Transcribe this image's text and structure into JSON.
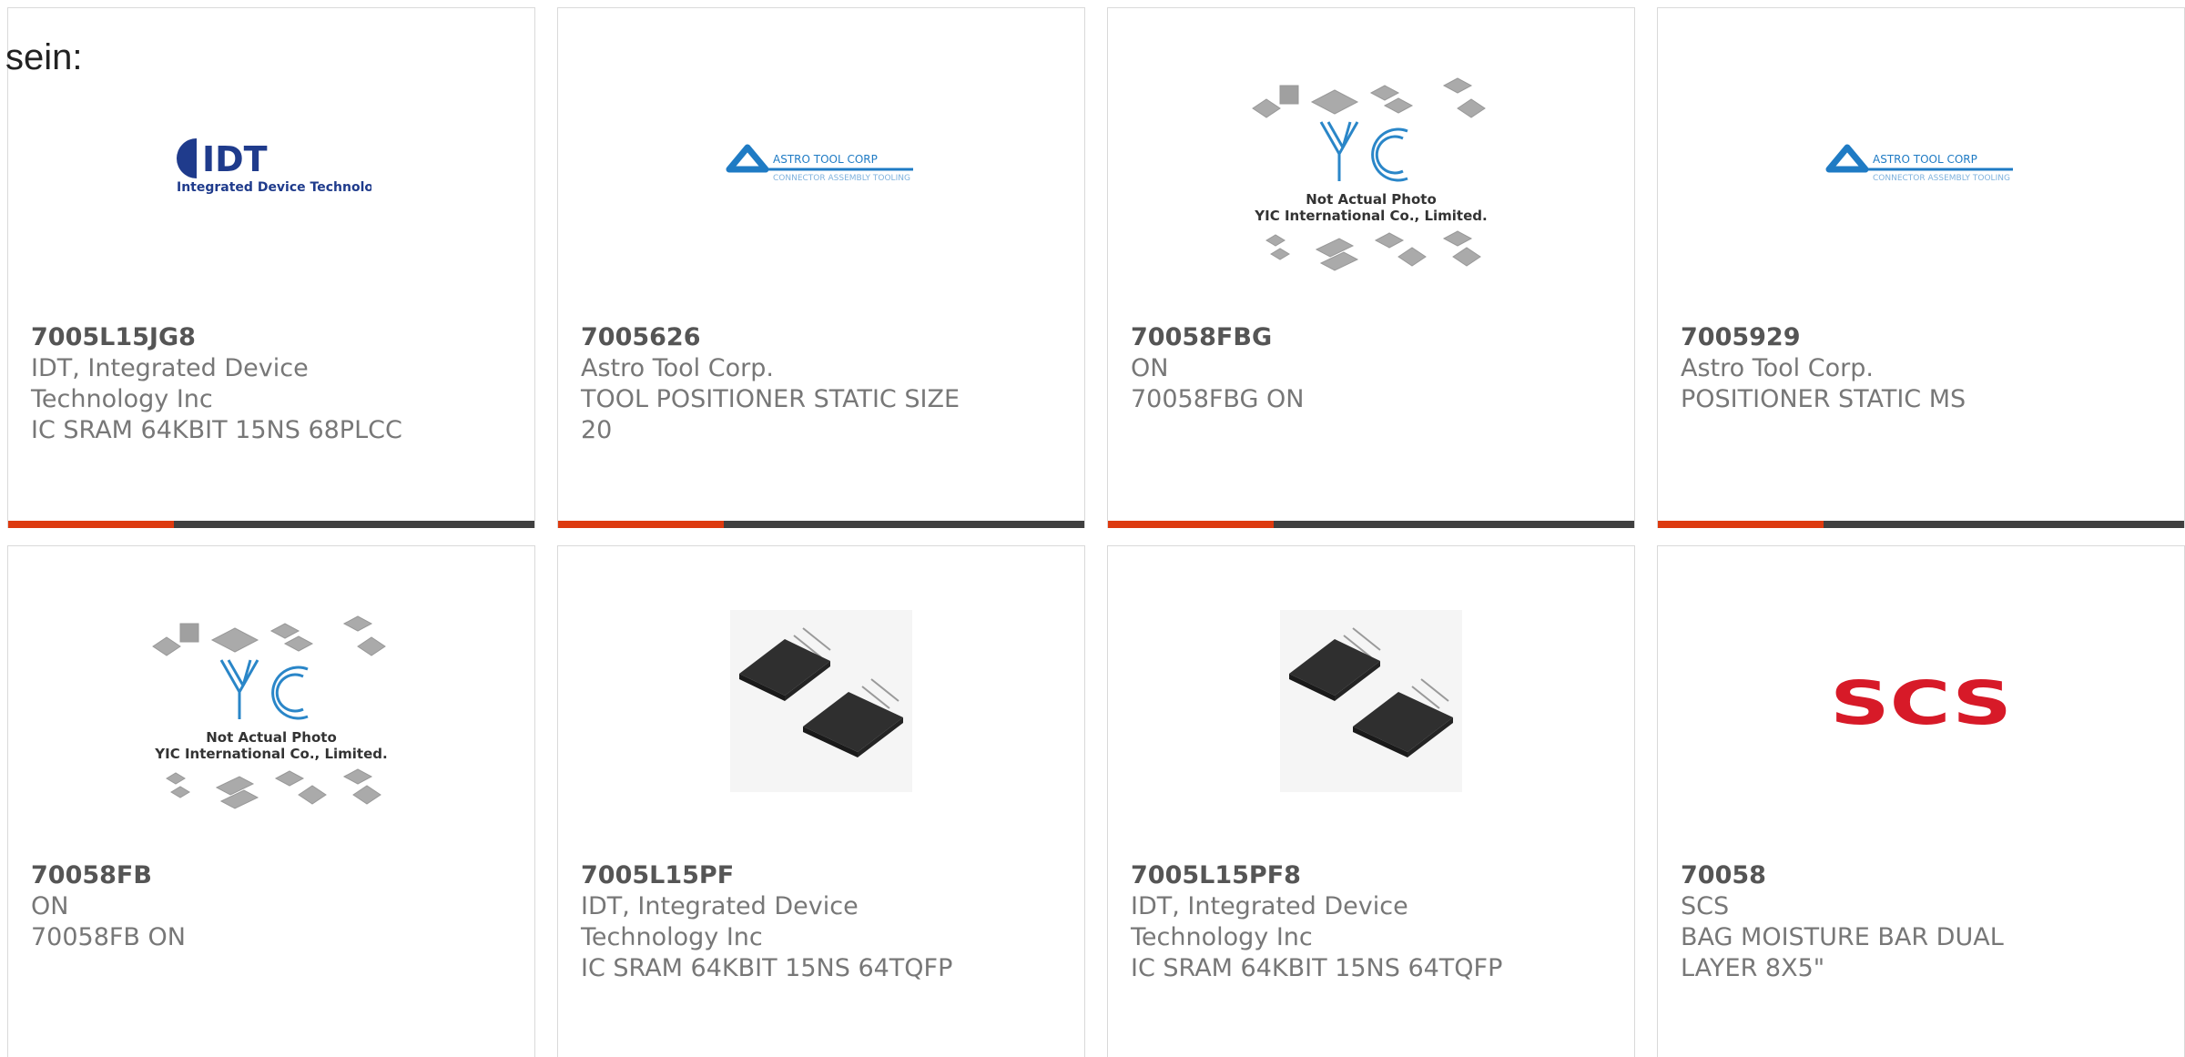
{
  "intro_text": "sein:",
  "colors": {
    "accent": "#dd3a10",
    "bar_dark": "#404040",
    "title_text": "#555555",
    "body_text": "#777777",
    "idt_blue": "#1f3b8c",
    "astro_blue": "#1f7bc4",
    "yic_blue": "#2a86c8",
    "scs_red": "#d71a28"
  },
  "products": [
    {
      "part_number": "7005L15JG8",
      "manufacturer": "IDT, Integrated Device Technology Inc",
      "description": "IC SRAM 64KBIT 15NS 68PLCC",
      "image_type": "idt-logo",
      "logo_text": "IDT",
      "logo_subtitle": "Integrated Device Technology"
    },
    {
      "part_number": "7005626",
      "manufacturer": "Astro Tool Corp.",
      "description": "TOOL POSITIONER STATIC SIZE 20",
      "image_type": "astro-logo",
      "logo_text": "ASTRO TOOL CORP",
      "logo_subtitle": "CONNECTOR ASSEMBLY TOOLING"
    },
    {
      "part_number": "70058FBG",
      "manufacturer": "ON",
      "description": "70058FBG ON",
      "image_type": "yic-placeholder",
      "logo_text": "YIC",
      "caption_line1": "Not Actual Photo",
      "caption_line2": "YIC International Co., Limited."
    },
    {
      "part_number": "7005929",
      "manufacturer": "Astro Tool Corp.",
      "description": "POSITIONER STATIC MS",
      "image_type": "astro-logo",
      "logo_text": "ASTRO TOOL CORP",
      "logo_subtitle": "CONNECTOR ASSEMBLY TOOLING"
    },
    {
      "part_number": "70058FB",
      "manufacturer": "ON",
      "description": "70058FB ON",
      "image_type": "yic-placeholder",
      "logo_text": "YIC",
      "caption_line1": "Not Actual Photo",
      "caption_line2": "YIC International Co., Limited."
    },
    {
      "part_number": "7005L15PF",
      "manufacturer": "IDT, Integrated Device Technology Inc",
      "description": "IC SRAM 64KBIT 15NS 64TQFP",
      "image_type": "tqfp-chip-photo"
    },
    {
      "part_number": "7005L15PF8",
      "manufacturer": "IDT, Integrated Device Technology Inc",
      "description": "IC SRAM 64KBIT 15NS 64TQFP",
      "image_type": "tqfp-chip-photo"
    },
    {
      "part_number": "70058",
      "manufacturer": "SCS",
      "description": "BAG MOISTURE BAR DUAL LAYER 8X5\"",
      "image_type": "scs-logo",
      "logo_text": "SCS"
    }
  ]
}
